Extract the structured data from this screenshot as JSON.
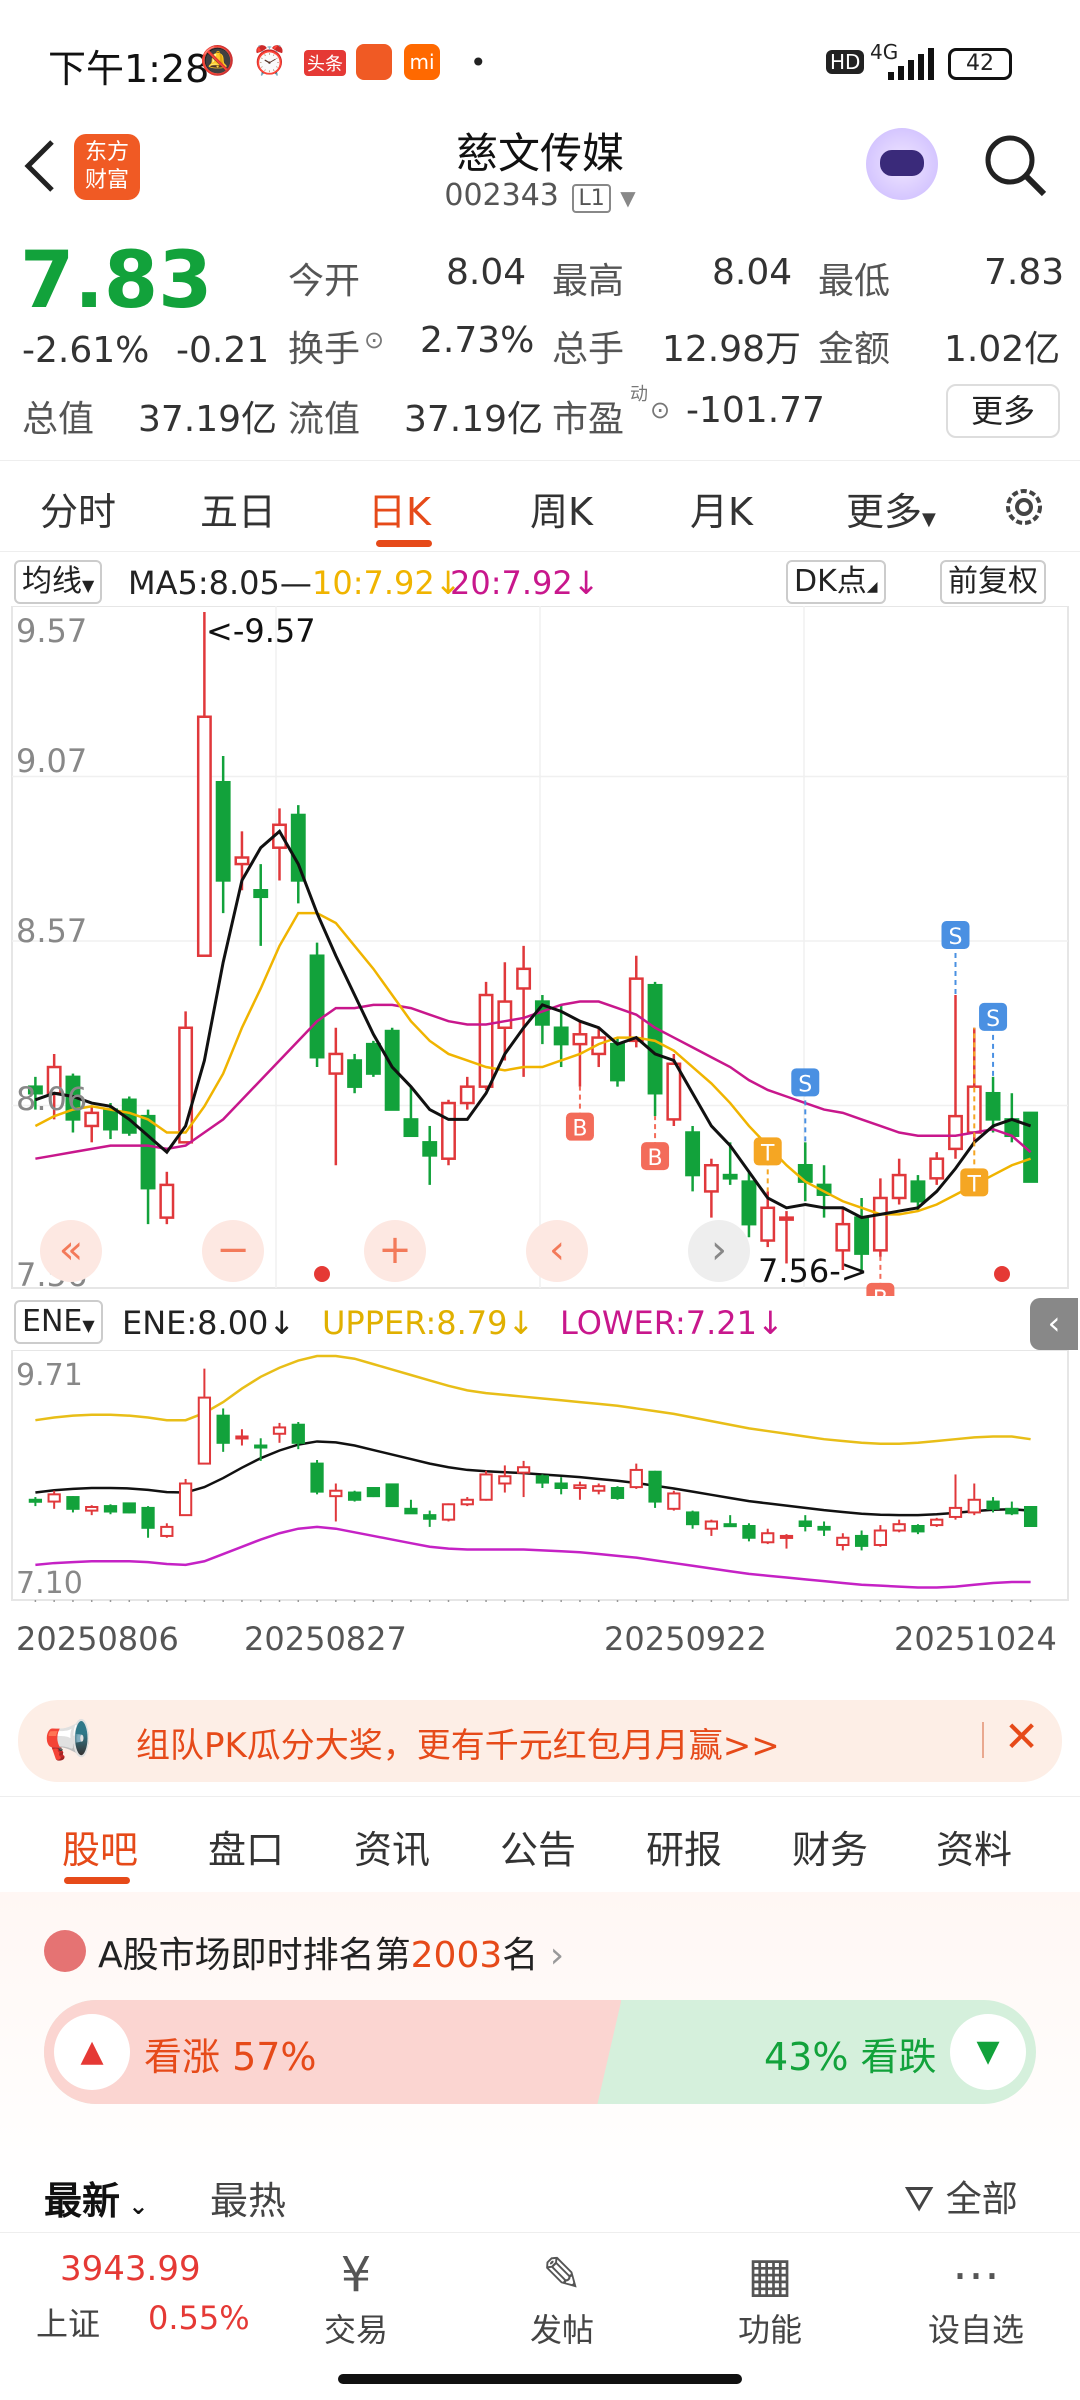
{
  "status_bar": {
    "time": "下午1:28",
    "badge_toutiao": "头条",
    "network": "4G",
    "hd": "HD",
    "battery": "42"
  },
  "header": {
    "logo_line1": "东方",
    "logo_line2": "财富",
    "stock_name": "慈文传媒",
    "stock_code": "002343",
    "level": "L1"
  },
  "quote": {
    "price": "7.83",
    "change_pct": "-2.61%",
    "change": "-0.21",
    "open_label": "今开",
    "open": "8.04",
    "high_label": "最高",
    "high": "8.04",
    "low_label": "最低",
    "low": "7.83",
    "turnover_label": "换手",
    "turnover": "2.73%",
    "volume_label": "总手",
    "volume": "12.98万",
    "amount_label": "金额",
    "amount": "1.02亿",
    "mktcap_label": "总值",
    "mktcap": "37.19亿",
    "float_label": "流值",
    "float_cap": "37.19亿",
    "pe_label": "市盈",
    "pe_sup": "动",
    "pe": "-101.77",
    "more": "更多"
  },
  "tabs": [
    "分时",
    "五日",
    "日K",
    "周K",
    "月K",
    "更多"
  ],
  "active_tab": 2,
  "ma_legend": {
    "select": "均线",
    "ma5": "MA5:8.05—",
    "ma10": "10:7.92↓",
    "ma20": "20:7.92↓",
    "dk": "DK点",
    "adjust": "前复权"
  },
  "colors": {
    "up": "#e0383b",
    "down": "#12a23b",
    "ma5": "#111111",
    "ma10": "#f0b400",
    "ma20": "#c8178c",
    "accent": "#e64a19"
  },
  "chart_data": {
    "type": "candlestick",
    "price_axis": [
      "9.57",
      "9.07",
      "8.57",
      "8.06",
      "7.56"
    ],
    "ylim": [
      7.56,
      9.57
    ],
    "annot_high": "<-9.57",
    "annot_low": "7.56->",
    "candles": [
      [
        8.12,
        8.15,
        8.05,
        8.1
      ],
      [
        8.1,
        8.22,
        8.02,
        8.18
      ],
      [
        8.15,
        8.16,
        7.98,
        8.02
      ],
      [
        8.0,
        8.06,
        7.95,
        8.04
      ],
      [
        8.05,
        8.07,
        7.96,
        7.99
      ],
      [
        8.08,
        8.09,
        7.97,
        7.98
      ],
      [
        8.03,
        8.05,
        7.7,
        7.81
      ],
      [
        7.72,
        7.86,
        7.7,
        7.82
      ],
      [
        7.95,
        8.35,
        7.95,
        8.3
      ],
      [
        8.52,
        9.57,
        8.52,
        9.25
      ],
      [
        9.05,
        9.13,
        8.65,
        8.75
      ],
      [
        8.8,
        8.9,
        8.72,
        8.82
      ],
      [
        8.72,
        8.8,
        8.55,
        8.7
      ],
      [
        8.85,
        8.97,
        8.75,
        8.92
      ],
      [
        8.95,
        8.98,
        8.68,
        8.75
      ],
      [
        8.52,
        8.56,
        8.18,
        8.21
      ],
      [
        8.16,
        8.3,
        7.88,
        8.22
      ],
      [
        8.2,
        8.22,
        8.1,
        8.12
      ],
      [
        8.25,
        8.26,
        8.15,
        8.16
      ],
      [
        8.29,
        8.3,
        8.05,
        8.05
      ],
      [
        8.02,
        8.12,
        7.97,
        7.97
      ],
      [
        7.95,
        8.0,
        7.82,
        7.91
      ],
      [
        7.9,
        8.08,
        7.88,
        8.07
      ],
      [
        8.07,
        8.15,
        8.05,
        8.12
      ],
      [
        8.12,
        8.44,
        8.11,
        8.4
      ],
      [
        8.3,
        8.5,
        8.2,
        8.38
      ],
      [
        8.42,
        8.55,
        8.15,
        8.48
      ],
      [
        8.38,
        8.4,
        8.25,
        8.31
      ],
      [
        8.3,
        8.37,
        8.18,
        8.25
      ],
      [
        8.25,
        8.32,
        8.12,
        8.28
      ],
      [
        8.22,
        8.3,
        8.18,
        8.27
      ],
      [
        8.25,
        8.27,
        8.12,
        8.14
      ],
      [
        8.26,
        8.52,
        8.24,
        8.45
      ],
      [
        8.43,
        8.44,
        8.03,
        8.1
      ],
      [
        8.02,
        8.22,
        8.0,
        8.19
      ],
      [
        7.98,
        8.0,
        7.8,
        7.85
      ],
      [
        7.8,
        7.9,
        7.72,
        7.88
      ],
      [
        7.85,
        7.95,
        7.82,
        7.84
      ],
      [
        7.83,
        7.86,
        7.66,
        7.7
      ],
      [
        7.65,
        7.8,
        7.63,
        7.75
      ],
      [
        7.72,
        7.74,
        7.58,
        7.72
      ],
      [
        7.88,
        7.95,
        7.77,
        7.83
      ],
      [
        7.82,
        7.88,
        7.72,
        7.79
      ],
      [
        7.62,
        7.75,
        7.56,
        7.7
      ],
      [
        7.72,
        7.78,
        7.56,
        7.61
      ],
      [
        7.62,
        7.84,
        7.6,
        7.78
      ],
      [
        7.78,
        7.9,
        7.76,
        7.85
      ],
      [
        7.83,
        7.85,
        7.74,
        7.77
      ],
      [
        7.84,
        7.92,
        7.82,
        7.9
      ],
      [
        7.93,
        8.4,
        7.9,
        8.03
      ],
      [
        7.98,
        8.3,
        7.95,
        8.12
      ],
      [
        8.1,
        8.15,
        7.98,
        8.02
      ],
      [
        8.02,
        8.1,
        7.95,
        7.97
      ],
      [
        8.04,
        8.04,
        7.83,
        7.83
      ]
    ],
    "ma5": [
      8.08,
      8.1,
      8.09,
      8.07,
      8.06,
      8.02,
      7.97,
      7.92,
      8.0,
      8.2,
      8.5,
      8.75,
      8.85,
      8.9,
      8.8,
      8.65,
      8.52,
      8.4,
      8.28,
      8.18,
      8.12,
      8.05,
      8.02,
      8.02,
      8.1,
      8.22,
      8.3,
      8.37,
      8.35,
      8.32,
      8.3,
      8.25,
      8.27,
      8.22,
      8.2,
      8.1,
      8.0,
      7.94,
      7.86,
      7.78,
      7.75,
      7.76,
      7.75,
      7.75,
      7.72,
      7.73,
      7.74,
      7.75,
      7.8,
      7.87,
      7.95,
      8.0,
      8.02,
      8.0
    ],
    "ma10": [
      8.0,
      8.03,
      8.05,
      8.06,
      8.05,
      8.04,
      8.02,
      7.98,
      7.98,
      8.06,
      8.16,
      8.3,
      8.42,
      8.55,
      8.65,
      8.65,
      8.62,
      8.55,
      8.48,
      8.4,
      8.32,
      8.26,
      8.22,
      8.2,
      8.18,
      8.17,
      8.18,
      8.18,
      8.2,
      8.22,
      8.25,
      8.27,
      8.27,
      8.26,
      8.23,
      8.18,
      8.13,
      8.07,
      8.0,
      7.94,
      7.88,
      7.83,
      7.8,
      7.77,
      7.75,
      7.73,
      7.73,
      7.74,
      7.76,
      7.79,
      7.82,
      7.85,
      7.88,
      7.9
    ],
    "ma20": [
      7.9,
      7.91,
      7.92,
      7.93,
      7.94,
      7.94,
      7.94,
      7.93,
      7.94,
      7.98,
      8.02,
      8.08,
      8.14,
      8.2,
      8.26,
      8.32,
      8.36,
      8.36,
      8.37,
      8.37,
      8.36,
      8.34,
      8.32,
      8.31,
      8.31,
      8.32,
      8.33,
      8.35,
      8.37,
      8.38,
      8.38,
      8.36,
      8.34,
      8.3,
      8.27,
      8.24,
      8.21,
      8.18,
      8.14,
      8.11,
      8.09,
      8.07,
      8.05,
      8.04,
      8.02,
      8.0,
      7.98,
      7.97,
      7.97,
      7.97,
      7.98,
      7.99,
      7.97,
      7.92
    ],
    "signals": [
      {
        "type": "B",
        "index": 29
      },
      {
        "type": "B",
        "index": 33
      },
      {
        "type": "T",
        "index": 39
      },
      {
        "type": "S",
        "index": 41
      },
      {
        "type": "B",
        "index": 45
      },
      {
        "type": "S",
        "index": 49
      },
      {
        "type": "S",
        "index": 51
      },
      {
        "type": "T",
        "index": 50
      }
    ],
    "ene": {
      "select": "ENE",
      "ene": "ENE:8.00↓",
      "upper": "UPPER:8.79↓",
      "lower": "LOWER:7.21↓",
      "axis": [
        "9.71",
        "7.10"
      ],
      "ylim": [
        7.1,
        9.71
      ],
      "upper_line": [
        9.0,
        9.03,
        9.05,
        9.06,
        9.06,
        9.05,
        9.03,
        9.0,
        9.0,
        9.08,
        9.2,
        9.35,
        9.48,
        9.58,
        9.66,
        9.71,
        9.71,
        9.68,
        9.62,
        9.56,
        9.5,
        9.44,
        9.38,
        9.33,
        9.3,
        9.28,
        9.26,
        9.24,
        9.22,
        9.2,
        9.18,
        9.16,
        9.13,
        9.1,
        9.07,
        9.03,
        8.99,
        8.95,
        8.91,
        8.88,
        8.85,
        8.82,
        8.79,
        8.77,
        8.75,
        8.74,
        8.74,
        8.75,
        8.77,
        8.79,
        8.81,
        8.82,
        8.82,
        8.79
      ],
      "lower_line": [
        7.4,
        7.42,
        7.43,
        7.44,
        7.44,
        7.44,
        7.43,
        7.41,
        7.4,
        7.44,
        7.52,
        7.6,
        7.68,
        7.75,
        7.8,
        7.82,
        7.8,
        7.76,
        7.72,
        7.68,
        7.64,
        7.6,
        7.58,
        7.57,
        7.57,
        7.57,
        7.57,
        7.56,
        7.55,
        7.54,
        7.52,
        7.5,
        7.48,
        7.45,
        7.42,
        7.39,
        7.36,
        7.33,
        7.3,
        7.28,
        7.26,
        7.24,
        7.22,
        7.2,
        7.18,
        7.17,
        7.16,
        7.15,
        7.15,
        7.16,
        7.18,
        7.2,
        7.21,
        7.21
      ]
    },
    "dates": [
      "20250806",
      "20250827",
      "20250922",
      "20251024"
    ]
  },
  "promo": {
    "text": "组队PK瓜分大奖，更有千元红包月月赢>>"
  },
  "section_tabs": [
    "股吧",
    "盘口",
    "资讯",
    "公告",
    "研报",
    "财务",
    "资料"
  ],
  "rank": {
    "prefix": "A股市场即时排名第",
    "rank": "2003",
    "suffix": "名"
  },
  "vote": {
    "bull": "看涨 57%",
    "bear": "43% 看跌",
    "bull_pct": 57
  },
  "feed": {
    "latest": "最新",
    "hot": "最热",
    "filter": "全部"
  },
  "bottom": {
    "index_value": "3943.99",
    "index_name": "上证",
    "index_pct": "0.55%",
    "trade": "交易",
    "post": "发帖",
    "func": "功能",
    "watch": "设自选"
  }
}
